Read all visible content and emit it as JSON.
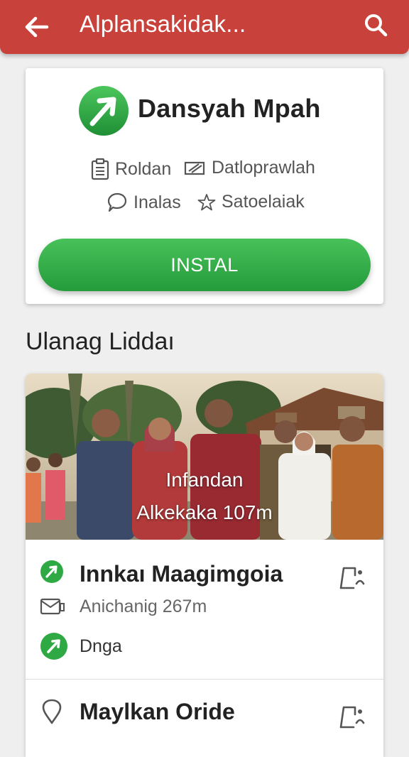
{
  "appbar": {
    "title": "Alplansakidak...",
    "back_icon": "arrow-left-icon",
    "search_icon": "search-icon",
    "color": "#c8413a"
  },
  "app": {
    "name": "Dansyah Mpah",
    "logo_icon": "green-arrow-logo",
    "meta": [
      {
        "icon": "clipboard-icon",
        "label": "Roldan"
      },
      {
        "icon": "ticket-icon",
        "label": "Datloprawlah"
      },
      {
        "icon": "chat-bubble-icon",
        "label": "Inalas"
      },
      {
        "icon": "star-icon",
        "label": "Satoelaiak"
      }
    ],
    "install_label": "INSTAL",
    "accent": "#2fa944"
  },
  "section": {
    "title": "Ulanag Liddaı"
  },
  "listing": {
    "photo_caption_line1": "Infandan",
    "photo_caption_line2": "Alkekaka 107m",
    "items": [
      {
        "icon": "green-arrow-icon",
        "title": "Innkaı Maagimgoia",
        "action_icon": "chat-person-icon",
        "sub_icon": "bus-icon",
        "sub_text": "Anichanig 267m",
        "extra_icon": "green-arrow-icon",
        "extra_text": "Dnga"
      },
      {
        "icon": "location-pin-icon",
        "title": "Maylkan Oride",
        "action_icon": "chat-person-icon"
      }
    ]
  }
}
